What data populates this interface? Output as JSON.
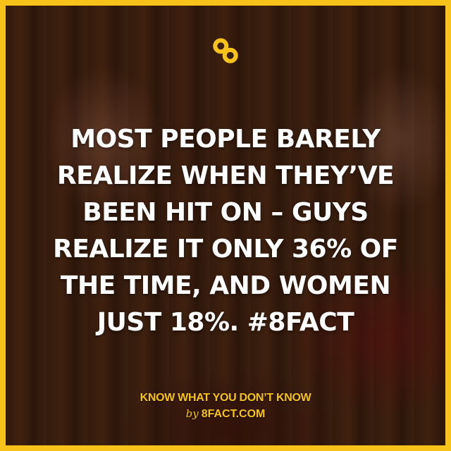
{
  "brand": {
    "logo_icon": "infinity-8-logo-icon",
    "accent_color": "#f7c21a"
  },
  "fact": {
    "lines": [
      "MOST PEOPLE BARELY",
      "REALIZE WHEN THEY’VE",
      "BEEN HIT ON – GUYS",
      "REALIZE IT ONLY 36% OF",
      "THE TIME, AND WOMEN",
      "JUST 18%. #8FACT"
    ]
  },
  "footer": {
    "tagline": "KNOW WHAT YOU DON’T KNOW",
    "by": "by",
    "site": "8FACT.COM"
  }
}
